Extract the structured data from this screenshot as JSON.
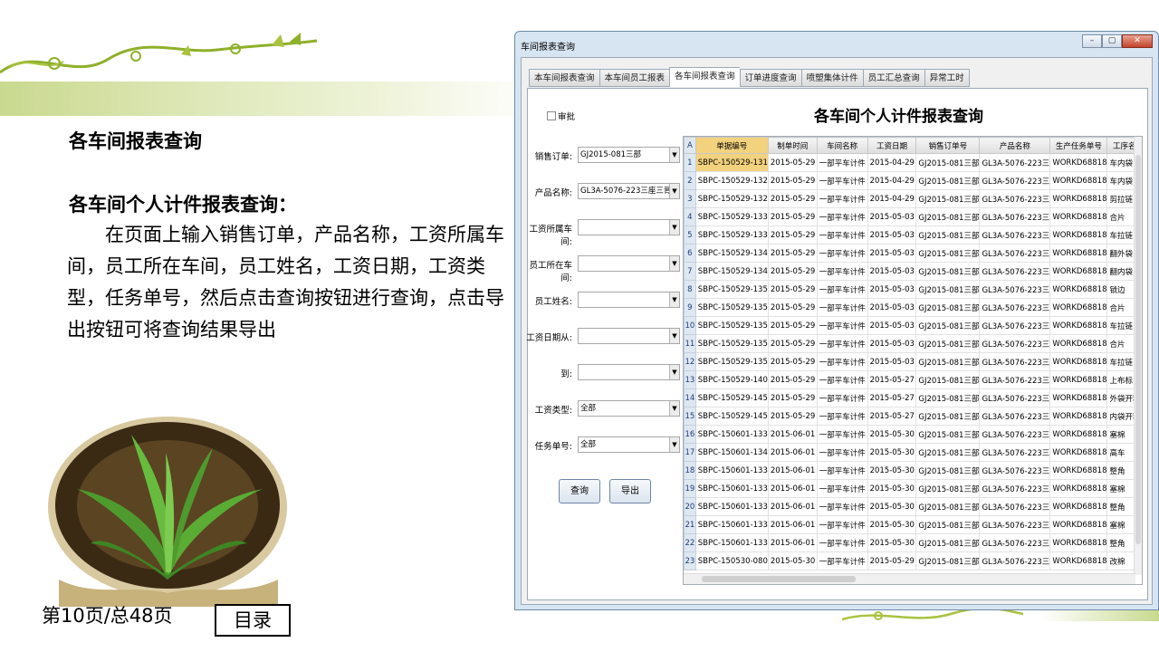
{
  "slide": {
    "title": "各车间报表查询",
    "subtitle": "各车间个人计件报表查询：",
    "body": "　　在页面上输入销售订单，产品名称，工资所属车间，员工所在车间，员工姓名，工资日期，工资类型，任务单号，然后点击查询按钮进行查询，点击导出按钮可将查询结果导出",
    "page_number": "第10页/总48页",
    "toc_label": "目录",
    "colors": {
      "band": "#c9d98f",
      "vine": "#8fb02a"
    }
  },
  "window": {
    "title": "车间报表查询",
    "tabs": [
      "本车间报表查询",
      "本车间员工报表",
      "各车间报表查询",
      "订单进度查询",
      "喷塑集体计件",
      "员工汇总查询",
      "异常工时"
    ],
    "active_tab": 2,
    "report_title": "各车间个人计件报表查询",
    "audit_label": "审批",
    "form": {
      "order": {
        "label": "销售订单:",
        "value": "GJ2015-081三部"
      },
      "product": {
        "label": "产品名称:",
        "value": "GL3A-5076-223三座三背垫"
      },
      "pay_workshop": {
        "label": "工资所属车间:",
        "value": ""
      },
      "emp_workshop": {
        "label": "员工所在车间:",
        "value": ""
      },
      "emp_name": {
        "label": "员工姓名:",
        "value": ""
      },
      "date_from": {
        "label": "工资日期从:",
        "value": ""
      },
      "date_to": {
        "label": "到:",
        "value": ""
      },
      "pay_type": {
        "label": "工资类型:",
        "value": "全部"
      },
      "task_no": {
        "label": "任务单号:",
        "value": "全部"
      }
    },
    "buttons": {
      "query": "查询",
      "export": "导出"
    },
    "grid": {
      "corner": "A",
      "columns": [
        "单据编号",
        "制单时间",
        "车间名称",
        "工资日期",
        "销售订单号",
        "产品名称",
        "生产任务单号",
        "工序名"
      ],
      "rows": [
        [
          "1",
          "SBPC-150529-131",
          "2015-05-29",
          "一部平车计件",
          "2015-04-29",
          "GJ2015-081三部",
          "GL3A-5076-223三",
          "WORKD68818",
          "车内袋"
        ],
        [
          "2",
          "SBPC-150529-132",
          "2015-05-29",
          "一部平车计件",
          "2015-04-29",
          "GJ2015-081三部",
          "GL3A-5076-223三",
          "WORKD68818",
          "车内袋"
        ],
        [
          "3",
          "SBPC-150529-132",
          "2015-05-29",
          "一部平车计件",
          "2015-04-29",
          "GJ2015-081三部",
          "GL3A-5076-223三",
          "WORKD68818",
          "剪拉链"
        ],
        [
          "4",
          "SBPC-150529-133",
          "2015-05-29",
          "一部平车计件",
          "2015-05-03",
          "GJ2015-081三部",
          "GL3A-5076-223三",
          "WORKD68818",
          "合片"
        ],
        [
          "5",
          "SBPC-150529-133",
          "2015-05-29",
          "一部平车计件",
          "2015-05-03",
          "GJ2015-081三部",
          "GL3A-5076-223三",
          "WORKD68818",
          "车拉链"
        ],
        [
          "6",
          "SBPC-150529-134",
          "2015-05-29",
          "一部平车计件",
          "2015-05-03",
          "GJ2015-081三部",
          "GL3A-5076-223三",
          "WORKD68818",
          "翻外袋"
        ],
        [
          "7",
          "SBPC-150529-134",
          "2015-05-29",
          "一部平车计件",
          "2015-05-03",
          "GJ2015-081三部",
          "GL3A-5076-223三",
          "WORKD68818",
          "翻内袋"
        ],
        [
          "8",
          "SBPC-150529-135",
          "2015-05-29",
          "一部平车计件",
          "2015-05-03",
          "GJ2015-081三部",
          "GL3A-5076-223三",
          "WORKD68818",
          "锁边"
        ],
        [
          "9",
          "SBPC-150529-135",
          "2015-05-29",
          "一部平车计件",
          "2015-05-03",
          "GJ2015-081三部",
          "GL3A-5076-223三",
          "WORKD68818",
          "合片"
        ],
        [
          "10",
          "SBPC-150529-135",
          "2015-05-29",
          "一部平车计件",
          "2015-05-03",
          "GJ2015-081三部",
          "GL3A-5076-223三",
          "WORKD68818",
          "车拉链"
        ],
        [
          "11",
          "SBPC-150529-135",
          "2015-05-29",
          "一部平车计件",
          "2015-05-03",
          "GJ2015-081三部",
          "GL3A-5076-223三",
          "WORKD68818",
          "合片"
        ],
        [
          "12",
          "SBPC-150529-135",
          "2015-05-29",
          "一部平车计件",
          "2015-05-03",
          "GJ2015-081三部",
          "GL3A-5076-223三",
          "WORKD68818",
          "车拉链"
        ],
        [
          "13",
          "SBPC-150529-140",
          "2015-05-29",
          "一部平车计件",
          "2015-05-27",
          "GJ2015-081三部",
          "GL3A-5076-223三",
          "WORKD68818",
          "上布标"
        ],
        [
          "14",
          "SBPC-150529-145",
          "2015-05-29",
          "一部平车计件",
          "2015-05-27",
          "GJ2015-081三部",
          "GL3A-5076-223三",
          "WORKD68818",
          "外袋开料"
        ],
        [
          "15",
          "SBPC-150529-145",
          "2015-05-29",
          "一部平车计件",
          "2015-05-27",
          "GJ2015-081三部",
          "GL3A-5076-223三",
          "WORKD68818",
          "内袋开料"
        ],
        [
          "16",
          "SBPC-150601-133",
          "2015-06-01",
          "一部平车计件",
          "2015-05-30",
          "GJ2015-081三部",
          "GL3A-5076-223三",
          "WORKD68818",
          "塞棉"
        ],
        [
          "17",
          "SBPC-150601-134",
          "2015-06-01",
          "一部平车计件",
          "2015-05-30",
          "GJ2015-081三部",
          "GL3A-5076-223三",
          "WORKD68818",
          "高车"
        ],
        [
          "18",
          "SBPC-150601-133",
          "2015-06-01",
          "一部平车计件",
          "2015-05-30",
          "GJ2015-081三部",
          "GL3A-5076-223三",
          "WORKD68818",
          "整角"
        ],
        [
          "19",
          "SBPC-150601-133",
          "2015-06-01",
          "一部平车计件",
          "2015-05-30",
          "GJ2015-081三部",
          "GL3A-5076-223三",
          "WORKD68818",
          "塞棉"
        ],
        [
          "20",
          "SBPC-150601-133",
          "2015-06-01",
          "一部平车计件",
          "2015-05-30",
          "GJ2015-081三部",
          "GL3A-5076-223三",
          "WORKD68818",
          "整角"
        ],
        [
          "21",
          "SBPC-150601-133",
          "2015-06-01",
          "一部平车计件",
          "2015-05-30",
          "GJ2015-081三部",
          "GL3A-5076-223三",
          "WORKD68818",
          "塞棉"
        ],
        [
          "22",
          "SBPC-150601-133",
          "2015-06-01",
          "一部平车计件",
          "2015-05-30",
          "GJ2015-081三部",
          "GL3A-5076-223三",
          "WORKD68818",
          "整角"
        ],
        [
          "23",
          "SBPC-150530-080",
          "2015-05-30",
          "一部平车计件",
          "2015-05-29",
          "GJ2015-081三部",
          "GL3A-5076-223三",
          "WORKD68818",
          "改棉"
        ]
      ]
    }
  }
}
